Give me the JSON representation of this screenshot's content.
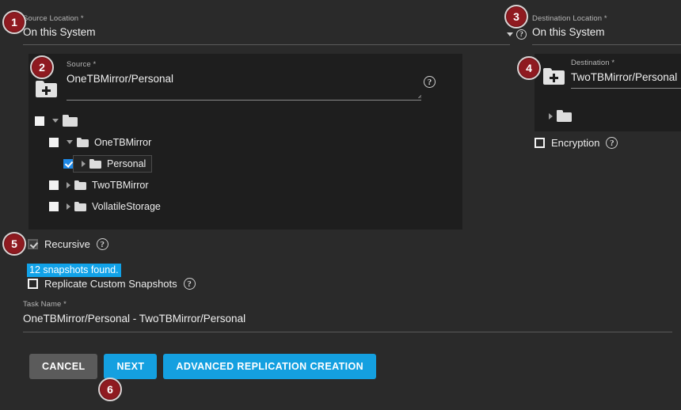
{
  "source_location": {
    "label": "Source Location *",
    "value": "On this System"
  },
  "destination_location": {
    "label": "Destination Location *",
    "value": "On this System"
  },
  "source_field": {
    "label": "Source *",
    "value": "OneTBMirror/Personal"
  },
  "destination_field": {
    "label": "Destination *",
    "value": "TwoTBMirror/Personal"
  },
  "source_tree": [
    {
      "label": "",
      "depth": 0,
      "checkbox": "unchecked",
      "caret": "down",
      "focused": false
    },
    {
      "label": "OneTBMirror",
      "depth": 1,
      "checkbox": "unchecked",
      "caret": "down",
      "focused": false
    },
    {
      "label": "Personal",
      "depth": 2,
      "checkbox": "checked",
      "caret": "right",
      "focused": true
    },
    {
      "label": "TwoTBMirror",
      "depth": 1,
      "checkbox": "unchecked",
      "caret": "right",
      "focused": false
    },
    {
      "label": "VollatileStorage",
      "depth": 1,
      "checkbox": "unchecked",
      "caret": "right",
      "focused": false
    }
  ],
  "destination_tree": [
    {
      "label": "",
      "depth": 0,
      "checkbox": "none",
      "caret": "right",
      "focused": false
    }
  ],
  "encryption": {
    "label": "Encryption",
    "checked": false
  },
  "recursive": {
    "label": "Recursive",
    "checked": true
  },
  "snapshots_found": "12 snapshots found.",
  "replicate_custom_snapshots": {
    "label": "Replicate Custom Snapshots",
    "checked": false
  },
  "task_name": {
    "label": "Task Name *",
    "value": "OneTBMirror/Personal - TwoTBMirror/Personal"
  },
  "buttons": {
    "cancel": "CANCEL",
    "next": "NEXT",
    "advanced": "ADVANCED REPLICATION CREATION"
  },
  "icons": {
    "help": "?",
    "folder_add": "folder-plus-icon",
    "folder": "folder-icon",
    "dropdown_caret": "chevron-down-icon"
  },
  "colors": {
    "page_bg": "#2a2a2a",
    "panel_bg": "#1e1e1e",
    "accent_blue": "#14a0e0",
    "highlight_blue": "#11a2e8",
    "badge_red": "#8f1a20",
    "checkbox_blue": "#1e88e5"
  },
  "annotations": [
    {
      "number": "1"
    },
    {
      "number": "2"
    },
    {
      "number": "3"
    },
    {
      "number": "4"
    },
    {
      "number": "5"
    },
    {
      "number": "6"
    }
  ]
}
